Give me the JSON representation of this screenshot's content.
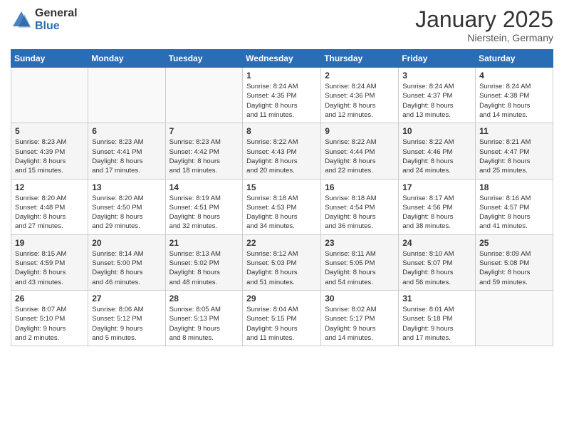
{
  "logo": {
    "general": "General",
    "blue": "Blue"
  },
  "header": {
    "month": "January 2025",
    "location": "Nierstein, Germany"
  },
  "weekdays": [
    "Sunday",
    "Monday",
    "Tuesday",
    "Wednesday",
    "Thursday",
    "Friday",
    "Saturday"
  ],
  "weeks": [
    [
      {
        "day": "",
        "info": ""
      },
      {
        "day": "",
        "info": ""
      },
      {
        "day": "",
        "info": ""
      },
      {
        "day": "1",
        "info": "Sunrise: 8:24 AM\nSunset: 4:35 PM\nDaylight: 8 hours\nand 11 minutes."
      },
      {
        "day": "2",
        "info": "Sunrise: 8:24 AM\nSunset: 4:36 PM\nDaylight: 8 hours\nand 12 minutes."
      },
      {
        "day": "3",
        "info": "Sunrise: 8:24 AM\nSunset: 4:37 PM\nDaylight: 8 hours\nand 13 minutes."
      },
      {
        "day": "4",
        "info": "Sunrise: 8:24 AM\nSunset: 4:38 PM\nDaylight: 8 hours\nand 14 minutes."
      }
    ],
    [
      {
        "day": "5",
        "info": "Sunrise: 8:23 AM\nSunset: 4:39 PM\nDaylight: 8 hours\nand 15 minutes."
      },
      {
        "day": "6",
        "info": "Sunrise: 8:23 AM\nSunset: 4:41 PM\nDaylight: 8 hours\nand 17 minutes."
      },
      {
        "day": "7",
        "info": "Sunrise: 8:23 AM\nSunset: 4:42 PM\nDaylight: 8 hours\nand 18 minutes."
      },
      {
        "day": "8",
        "info": "Sunrise: 8:22 AM\nSunset: 4:43 PM\nDaylight: 8 hours\nand 20 minutes."
      },
      {
        "day": "9",
        "info": "Sunrise: 8:22 AM\nSunset: 4:44 PM\nDaylight: 8 hours\nand 22 minutes."
      },
      {
        "day": "10",
        "info": "Sunrise: 8:22 AM\nSunset: 4:46 PM\nDaylight: 8 hours\nand 24 minutes."
      },
      {
        "day": "11",
        "info": "Sunrise: 8:21 AM\nSunset: 4:47 PM\nDaylight: 8 hours\nand 25 minutes."
      }
    ],
    [
      {
        "day": "12",
        "info": "Sunrise: 8:20 AM\nSunset: 4:48 PM\nDaylight: 8 hours\nand 27 minutes."
      },
      {
        "day": "13",
        "info": "Sunrise: 8:20 AM\nSunset: 4:50 PM\nDaylight: 8 hours\nand 29 minutes."
      },
      {
        "day": "14",
        "info": "Sunrise: 8:19 AM\nSunset: 4:51 PM\nDaylight: 8 hours\nand 32 minutes."
      },
      {
        "day": "15",
        "info": "Sunrise: 8:18 AM\nSunset: 4:53 PM\nDaylight: 8 hours\nand 34 minutes."
      },
      {
        "day": "16",
        "info": "Sunrise: 8:18 AM\nSunset: 4:54 PM\nDaylight: 8 hours\nand 36 minutes."
      },
      {
        "day": "17",
        "info": "Sunrise: 8:17 AM\nSunset: 4:56 PM\nDaylight: 8 hours\nand 38 minutes."
      },
      {
        "day": "18",
        "info": "Sunrise: 8:16 AM\nSunset: 4:57 PM\nDaylight: 8 hours\nand 41 minutes."
      }
    ],
    [
      {
        "day": "19",
        "info": "Sunrise: 8:15 AM\nSunset: 4:59 PM\nDaylight: 8 hours\nand 43 minutes."
      },
      {
        "day": "20",
        "info": "Sunrise: 8:14 AM\nSunset: 5:00 PM\nDaylight: 8 hours\nand 46 minutes."
      },
      {
        "day": "21",
        "info": "Sunrise: 8:13 AM\nSunset: 5:02 PM\nDaylight: 8 hours\nand 48 minutes."
      },
      {
        "day": "22",
        "info": "Sunrise: 8:12 AM\nSunset: 5:03 PM\nDaylight: 8 hours\nand 51 minutes."
      },
      {
        "day": "23",
        "info": "Sunrise: 8:11 AM\nSunset: 5:05 PM\nDaylight: 8 hours\nand 54 minutes."
      },
      {
        "day": "24",
        "info": "Sunrise: 8:10 AM\nSunset: 5:07 PM\nDaylight: 8 hours\nand 56 minutes."
      },
      {
        "day": "25",
        "info": "Sunrise: 8:09 AM\nSunset: 5:08 PM\nDaylight: 8 hours\nand 59 minutes."
      }
    ],
    [
      {
        "day": "26",
        "info": "Sunrise: 8:07 AM\nSunset: 5:10 PM\nDaylight: 9 hours\nand 2 minutes."
      },
      {
        "day": "27",
        "info": "Sunrise: 8:06 AM\nSunset: 5:12 PM\nDaylight: 9 hours\nand 5 minutes."
      },
      {
        "day": "28",
        "info": "Sunrise: 8:05 AM\nSunset: 5:13 PM\nDaylight: 9 hours\nand 8 minutes."
      },
      {
        "day": "29",
        "info": "Sunrise: 8:04 AM\nSunset: 5:15 PM\nDaylight: 9 hours\nand 11 minutes."
      },
      {
        "day": "30",
        "info": "Sunrise: 8:02 AM\nSunset: 5:17 PM\nDaylight: 9 hours\nand 14 minutes."
      },
      {
        "day": "31",
        "info": "Sunrise: 8:01 AM\nSunset: 5:18 PM\nDaylight: 9 hours\nand 17 minutes."
      },
      {
        "day": "",
        "info": ""
      }
    ]
  ]
}
